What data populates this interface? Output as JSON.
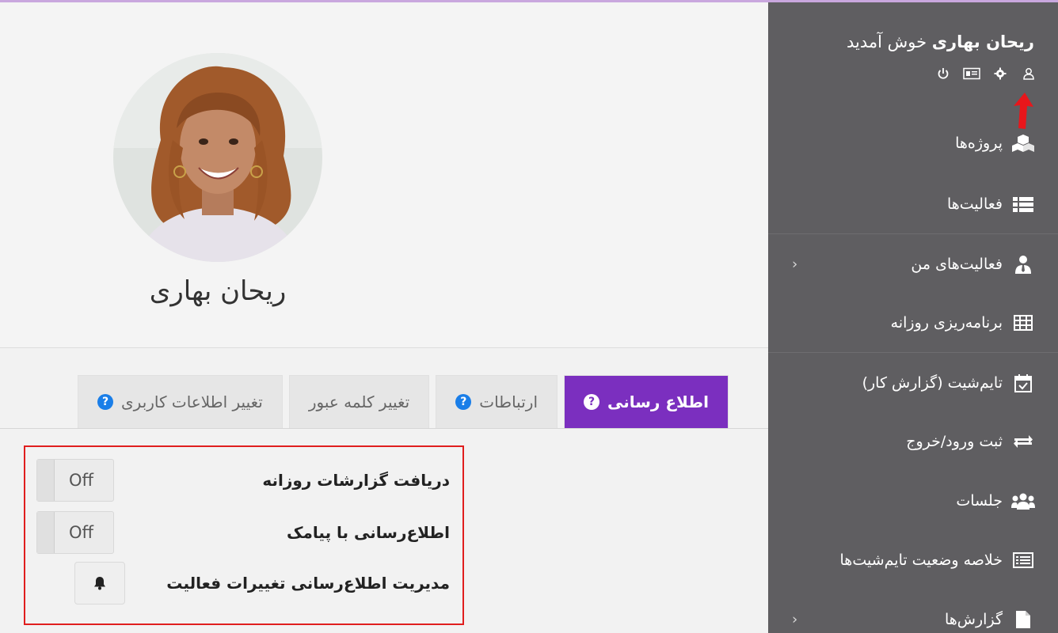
{
  "header": {
    "welcome_name": "ریحان بهاری",
    "welcome_text": "خوش آمدید"
  },
  "user_icons": [
    "profile-icon",
    "settings-icon",
    "id-card-icon",
    "power-icon"
  ],
  "sidebar": {
    "items": [
      {
        "label": "پروژه‌ها",
        "icon": "cubes-icon",
        "has_chevron": false
      },
      {
        "label": "فعالیت‌ها",
        "icon": "list-icon",
        "has_chevron": false
      },
      {
        "label": "فعالیت‌های من",
        "icon": "user-tie-icon",
        "has_chevron": true
      },
      {
        "label": "برنامه‌ریزی روزانه",
        "icon": "table-icon",
        "has_chevron": false
      },
      {
        "label": "تایم‌شیت (گزارش کار)",
        "icon": "calendar-check-icon",
        "has_chevron": false
      },
      {
        "label": "ثبت ورود/خروج",
        "icon": "exchange-icon",
        "has_chevron": false
      },
      {
        "label": "جلسات",
        "icon": "users-icon",
        "has_chevron": false
      },
      {
        "label": "خلاصه وضعیت تایم‌شیت‌ها",
        "icon": "list-alt-icon",
        "has_chevron": false
      },
      {
        "label": "گزارش‌ها",
        "icon": "file-icon",
        "has_chevron": true
      }
    ]
  },
  "profile": {
    "name": "ریحان بهاری"
  },
  "tabs": [
    {
      "label": "تغییر اطلاعات کاربری",
      "help": true,
      "active": false
    },
    {
      "label": "تغییر کلمه عبور",
      "help": false,
      "active": false
    },
    {
      "label": "ارتباطات",
      "help": true,
      "active": false
    },
    {
      "label": "اطلاع رسانی",
      "help": true,
      "active": true
    }
  ],
  "help_glyph": "?",
  "settings": {
    "daily_reports": {
      "label": "دریافت گزارشات روزانه",
      "value": "Off"
    },
    "sms_notify": {
      "label": "اطلاع‌رسانی با پیامک",
      "value": "Off"
    },
    "activity_changes": {
      "label": "مدیریت اطلاع‌رسانی تغییرات فعالیت"
    }
  },
  "colors": {
    "accent": "#7b2fbf",
    "sidebar_bg": "#5f5e61",
    "highlight_border": "#e01e1e",
    "help_blue": "#1a7ee8"
  }
}
